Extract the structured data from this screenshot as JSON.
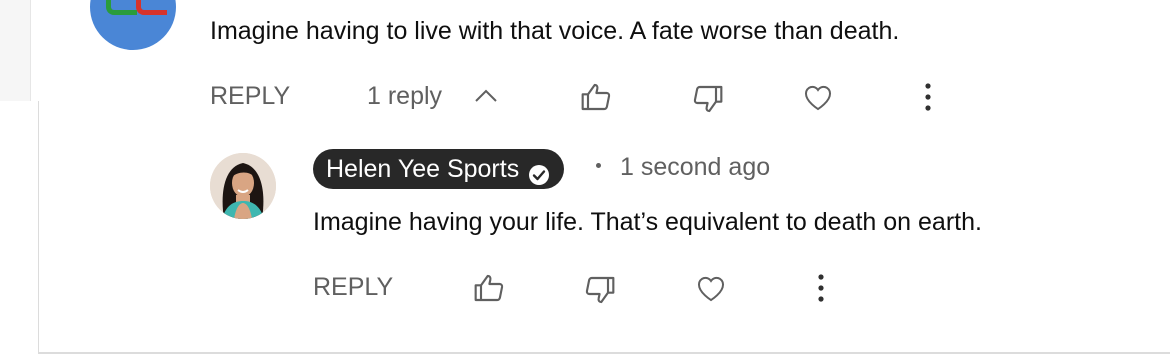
{
  "top_comment": {
    "text": "Imagine having to live with that voice. A fate worse than death.",
    "reply_label": "REPLY",
    "replies_toggle": "1 reply",
    "icons": [
      "like-icon",
      "dislike-icon",
      "heart-icon",
      "more-vert-icon",
      "chevron-up-icon"
    ]
  },
  "reply_comment": {
    "author": "Helen Yee Sports",
    "verified": true,
    "timestamp": "1 second ago",
    "text": "Imagine having your life. That’s equivalent to death on earth.",
    "reply_label": "REPLY",
    "icons": [
      "like-icon",
      "dislike-icon",
      "heart-icon",
      "more-vert-icon"
    ]
  },
  "colors": {
    "text": "#0f0f0f",
    "secondary": "#606060",
    "chip_bg": "#282828",
    "avatar_top_bg": "#4a86d6"
  }
}
